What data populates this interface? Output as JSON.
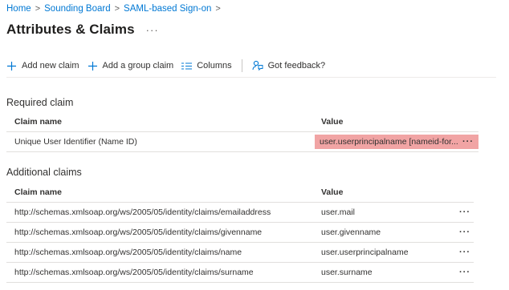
{
  "breadcrumb": {
    "items": [
      "Home",
      "Sounding Board",
      "SAML-based Sign-on"
    ],
    "separator": ">"
  },
  "page": {
    "title": "Attributes & Claims",
    "more": "···"
  },
  "toolbar": {
    "add_new_claim": "Add new claim",
    "add_group_claim": "Add a group claim",
    "columns": "Columns",
    "feedback": "Got feedback?"
  },
  "required": {
    "title": "Required claim",
    "headers": {
      "name": "Claim name",
      "value": "Value"
    },
    "rows": [
      {
        "name": "Unique User Identifier (Name ID)",
        "value": "user.userprincipalname [nameid-for...",
        "more": "···"
      }
    ]
  },
  "additional": {
    "title": "Additional claims",
    "headers": {
      "name": "Claim name",
      "value": "Value"
    },
    "rows": [
      {
        "name": "http://schemas.xmlsoap.org/ws/2005/05/identity/claims/emailaddress",
        "value": "user.mail",
        "more": "···"
      },
      {
        "name": "http://schemas.xmlsoap.org/ws/2005/05/identity/claims/givenname",
        "value": "user.givenname",
        "more": "···"
      },
      {
        "name": "http://schemas.xmlsoap.org/ws/2005/05/identity/claims/name",
        "value": "user.userprincipalname",
        "more": "···"
      },
      {
        "name": "http://schemas.xmlsoap.org/ws/2005/05/identity/claims/surname",
        "value": "user.surname",
        "more": "···"
      }
    ]
  },
  "colors": {
    "accent": "#0078d4",
    "highlight": "#f1a4a4",
    "border": "#e1dfdd"
  }
}
